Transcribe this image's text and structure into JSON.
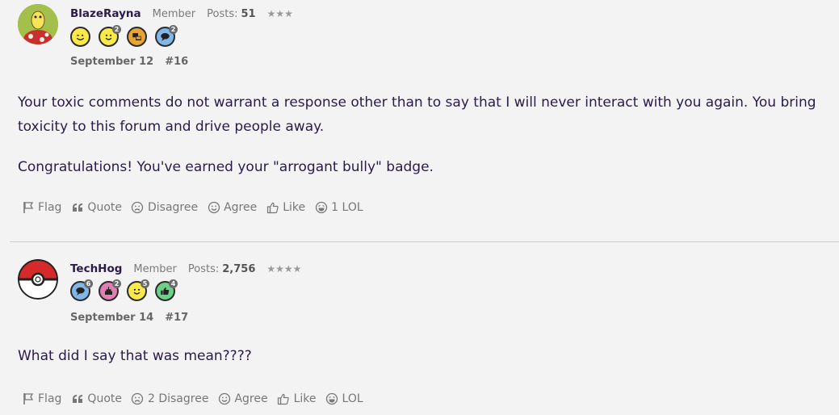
{
  "posts": [
    {
      "username": "BlazeRayna",
      "role": "Member",
      "posts_label": "Posts:",
      "posts_count": "51",
      "stars": "★★★",
      "avatar_icon": "shiny-shuckle-avatar",
      "badges": [
        {
          "icon": "wink-badge-icon",
          "glyph": "😉",
          "color": "#fbe94a",
          "count": ""
        },
        {
          "icon": "smile-badge-icon",
          "glyph": "🙂",
          "color": "#fbe94a",
          "count": "2"
        },
        {
          "icon": "computer-badge-icon",
          "glyph": "▤",
          "color": "#e8a536",
          "count": ""
        },
        {
          "icon": "chat-badge-icon",
          "glyph": "💬",
          "color": "#7fb7e8",
          "count": "2"
        }
      ],
      "date": "September 12",
      "number": "#16",
      "paragraphs": [
        "Your toxic comments do not warrant a response other than to say that I will never interact with you again. You bring toxicity to this forum and drive people away.",
        "Congratulations! You've earned your \"arrogant bully\" badge."
      ],
      "actions": {
        "flag": "Flag",
        "quote": "Quote",
        "disagree": "Disagree",
        "agree": "Agree",
        "like": "Like",
        "lol": "1 LOL"
      }
    },
    {
      "username": "TechHog",
      "role": "Member",
      "posts_label": "Posts:",
      "posts_count": "2,756",
      "stars": "★★★★",
      "avatar_icon": "pokeball-avatar",
      "badges": [
        {
          "icon": "chat-badge-icon",
          "glyph": "💬",
          "color": "#7fb7e8",
          "count": "6"
        },
        {
          "icon": "cake-badge-icon",
          "glyph": "▲",
          "color": "#e07fb2",
          "count": "2"
        },
        {
          "icon": "smile-badge-icon",
          "glyph": "🙂",
          "color": "#fbe94a",
          "count": "5"
        },
        {
          "icon": "thumbs-up-badge-icon",
          "glyph": "👍",
          "color": "#6fcf8a",
          "count": "4"
        }
      ],
      "date": "September 14",
      "number": "#17",
      "paragraphs": [
        "What did I say that was mean????"
      ],
      "actions": {
        "flag": "Flag",
        "quote": "Quote",
        "disagree": "2 Disagree",
        "agree": "Agree",
        "like": "Like",
        "lol": "LOL"
      }
    }
  ]
}
